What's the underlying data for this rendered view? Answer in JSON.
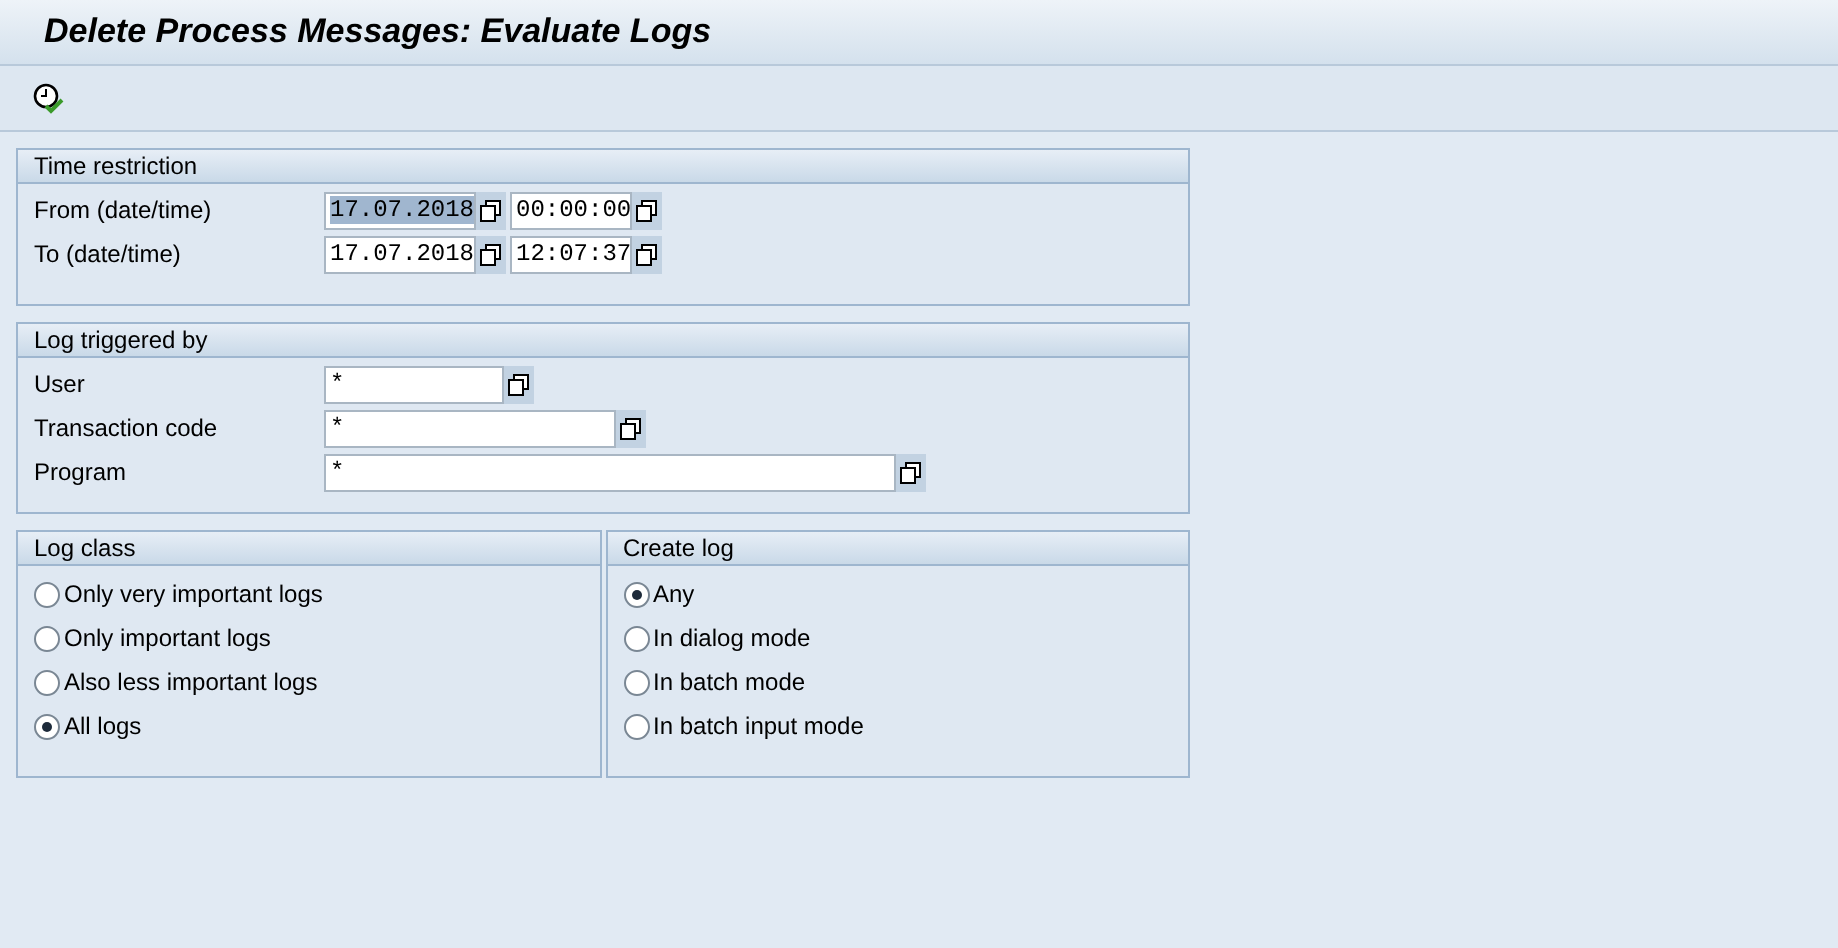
{
  "window": {
    "title": "Delete Process Messages: Evaluate Logs"
  },
  "time_restriction": {
    "title": "Time restriction",
    "rows": [
      {
        "label": "From (date/time)",
        "date": "17.07.2018",
        "date_selected": true,
        "time": "00:00:00"
      },
      {
        "label": "To (date/time)",
        "date": "17.07.2018",
        "date_selected": false,
        "time": "12:07:37"
      }
    ]
  },
  "log_triggered_by": {
    "title": "Log triggered by",
    "rows": [
      {
        "label": "User",
        "value": "*"
      },
      {
        "label": "Transaction code",
        "value": "*"
      },
      {
        "label": "Program",
        "value": "*"
      }
    ]
  },
  "log_class": {
    "title": "Log class",
    "options": [
      {
        "label": "Only very important logs",
        "selected": false
      },
      {
        "label": "Only important logs",
        "selected": false
      },
      {
        "label": "Also less important logs",
        "selected": false
      },
      {
        "label": "All logs",
        "selected": true
      }
    ]
  },
  "create_log": {
    "title": "Create log",
    "options": [
      {
        "label": "Any",
        "selected": true
      },
      {
        "label": "In dialog mode",
        "selected": false
      },
      {
        "label": "In batch mode",
        "selected": false
      },
      {
        "label": "In batch input mode",
        "selected": false
      }
    ]
  }
}
